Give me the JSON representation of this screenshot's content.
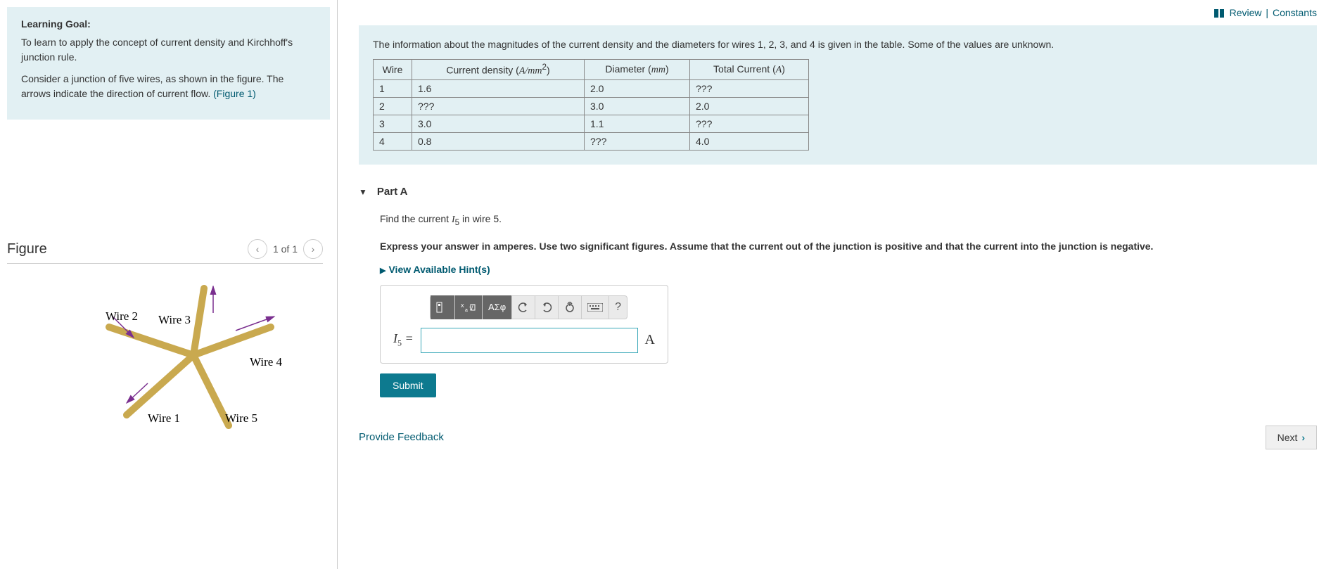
{
  "topLinks": {
    "review": "Review",
    "constants": "Constants"
  },
  "goal": {
    "title": "Learning Goal:",
    "p1": "To learn to apply the concept of current density and Kirchhoff's junction rule.",
    "p2a": "Consider a junction of five wires, as shown in the figure. The arrows indicate the direction of current flow. ",
    "figLink": "(Figure 1)"
  },
  "figurePanel": {
    "title": "Figure",
    "counter": "1 of 1",
    "labels": {
      "w1": "Wire 1",
      "w2": "Wire 2",
      "w3": "Wire 3",
      "w4": "Wire 4",
      "w5": "Wire 5"
    }
  },
  "info": {
    "text": "The information about the magnitudes of the current density and the diameters for wires 1, 2, 3, and 4 is given in the table. Some of the values are unknown.",
    "headers": {
      "wire": "Wire",
      "cd1": "Current density (",
      "cd2": ")",
      "diam1": "Diameter (",
      "diam2": ")",
      "tc1": "Total Current (",
      "tc2": ")"
    },
    "units": {
      "cd": "A/mm",
      "cdExp": "2",
      "diam": "mm",
      "tc": "A"
    },
    "rows": [
      {
        "wire": "1",
        "cd": "1.6",
        "diam": "2.0",
        "tc": "???"
      },
      {
        "wire": "2",
        "cd": "???",
        "diam": "3.0",
        "tc": "2.0"
      },
      {
        "wire": "3",
        "cd": "3.0",
        "diam": "1.1",
        "tc": "???"
      },
      {
        "wire": "4",
        "cd": "0.8",
        "diam": "???",
        "tc": "4.0"
      }
    ]
  },
  "partA": {
    "label": "Part A",
    "q1": "Find the current ",
    "qVar": "I",
    "qSub": "5",
    "q2": " in wire 5.",
    "instr": "Express your answer in amperes. Use two significant figures. Assume that the current out of the junction is positive and that the current into the junction is negative.",
    "hints": "View Available Hint(s)",
    "greek": "ΑΣφ",
    "help": "?",
    "varLabel": "I",
    "varSub": "5",
    "equals": " = ",
    "unit": "A",
    "submit": "Submit"
  },
  "bottom": {
    "feedback": "Provide Feedback",
    "next": "Next "
  }
}
